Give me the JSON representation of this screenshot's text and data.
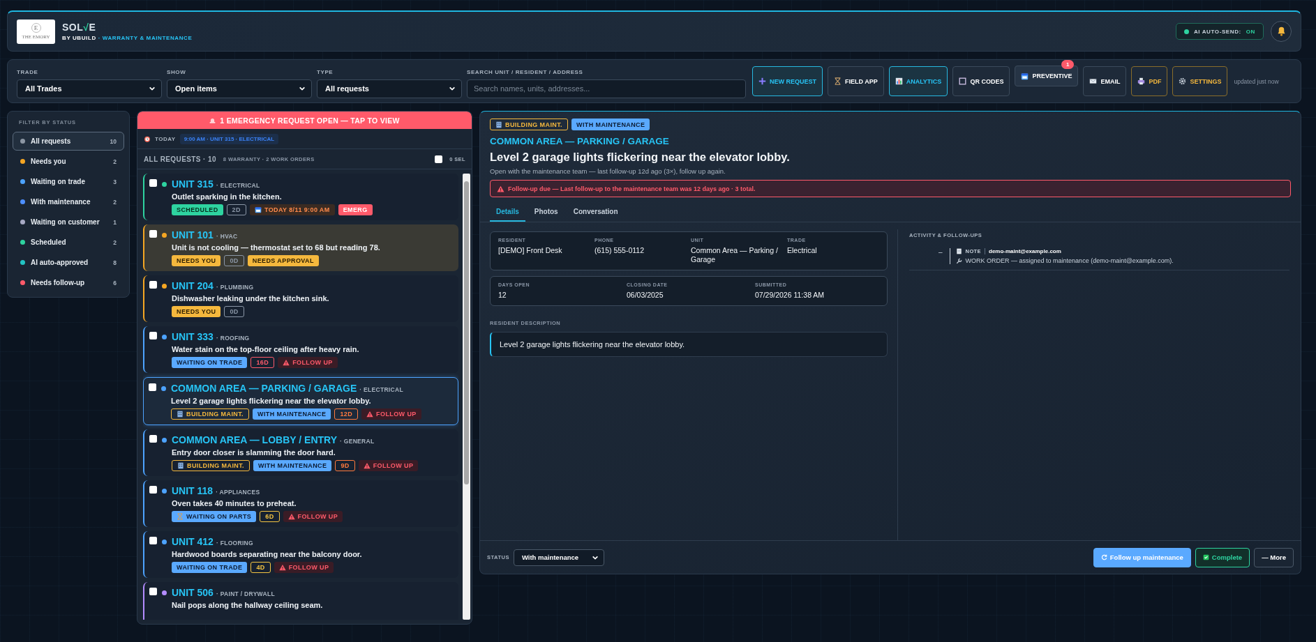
{
  "header": {
    "logo": {
      "initial": "E",
      "name": "THE EMORY"
    },
    "brand": {
      "name_parts": [
        "SOL",
        "√",
        "E"
      ],
      "tagline_parts": [
        "BY UBUILD",
        " · WARRANTY & MAINTENANCE"
      ]
    },
    "auto_send": {
      "label": "AI AUTO-SEND:",
      "value": "ON",
      "on": true
    }
  },
  "toolbar": {
    "filters": [
      {
        "label": "TRADE",
        "value": "All Trades"
      },
      {
        "label": "SHOW",
        "value": "Open items"
      },
      {
        "label": "TYPE",
        "value": "All requests"
      }
    ],
    "search": {
      "label": "SEARCH UNIT / RESIDENT / ADDRESS",
      "placeholder": "Search names, units, addresses..."
    },
    "buttons": [
      {
        "label": "NEW REQUEST",
        "kind": "accent"
      },
      {
        "label": "FIELD APP",
        "kind": "plain"
      },
      {
        "label": "ANALYTICS",
        "kind": "accent"
      },
      {
        "label": "QR CODES",
        "kind": "plain"
      },
      {
        "label": "PREVENTIVE",
        "kind": "compact",
        "badge": "1"
      },
      {
        "label": "EMAIL",
        "kind": "plain"
      },
      {
        "label": "PDF",
        "kind": "gold"
      },
      {
        "label": "SETTINGS",
        "kind": "gold"
      }
    ],
    "updated": "updated just now"
  },
  "sidebar": {
    "title": "FILTER BY STATUS",
    "items": [
      {
        "label": "All requests",
        "count": "10",
        "color": "#8c96a3",
        "selected": true
      },
      {
        "label": "Needs you",
        "count": "2",
        "color": "#f5a623",
        "selected": false
      },
      {
        "label": "Waiting on trade",
        "count": "3",
        "color": "#4da3ff",
        "selected": false
      },
      {
        "label": "With maintenance",
        "count": "2",
        "color": "#4d8fff",
        "selected": false
      },
      {
        "label": "Waiting on customer",
        "count": "1",
        "color": "#a7a9c4",
        "selected": false
      },
      {
        "label": "Scheduled",
        "count": "2",
        "color": "#2ed3a0",
        "selected": false
      },
      {
        "label": "AI auto-approved",
        "count": "8",
        "color": "#22c4c4",
        "selected": false
      },
      {
        "label": "Needs follow-up",
        "count": "6",
        "color": "#ff5a6a",
        "selected": false
      }
    ]
  },
  "list": {
    "emergency_banner": "1 EMERGENCY REQUEST OPEN — TAP TO VIEW",
    "today": {
      "label": "TODAY",
      "event": "9:00 AM · UNIT 315 · ELECTRICAL"
    },
    "heading": "ALL REQUESTS · 10",
    "breakdown": "8 WARRANTY · 2 WORK ORDERS",
    "select_all": {
      "checked": false,
      "label": "0 SEL"
    },
    "items": [
      {
        "unit": "UNIT 315",
        "trade": "· ELECTRICAL",
        "description": "Outlet sparking in the kitchen.",
        "color": "#2ed3a0",
        "checked": false,
        "selected": false,
        "highlighted": false,
        "tags": [
          {
            "kind": "scheduled",
            "text": "SCHEDULED"
          },
          {
            "kind": "age",
            "text": "2D",
            "color": "#8a96a6"
          },
          {
            "kind": "date",
            "text": "TODAY 8/11 9:00 AM"
          },
          {
            "kind": "emergency",
            "text": "EMERG"
          }
        ]
      },
      {
        "unit": "UNIT 101",
        "trade": "· HVAC",
        "description": "Unit is not cooling — thermostat set to 68 but reading 78.",
        "color": "#f5a623",
        "checked": false,
        "selected": false,
        "highlighted": true,
        "tags": [
          {
            "kind": "needs",
            "text": "NEEDS YOU"
          },
          {
            "kind": "age",
            "text": "0D",
            "color": "#8a96a6"
          },
          {
            "kind": "needs",
            "text": "NEEDS APPROVAL"
          }
        ]
      },
      {
        "unit": "UNIT 204",
        "trade": "· PLUMBING",
        "description": "Dishwasher leaking under the kitchen sink.",
        "color": "#f5a623",
        "checked": false,
        "selected": false,
        "highlighted": false,
        "tags": [
          {
            "kind": "needs",
            "text": "NEEDS YOU"
          },
          {
            "kind": "age",
            "text": "0D",
            "color": "#8a96a6"
          }
        ]
      },
      {
        "unit": "UNIT 333",
        "trade": "· ROOFING",
        "description": "Water stain on the top-floor ceiling after heavy rain.",
        "color": "#4da3ff",
        "checked": false,
        "selected": false,
        "highlighted": false,
        "tags": [
          {
            "kind": "waiting",
            "text": "WAITING ON TRADE"
          },
          {
            "kind": "age",
            "text": "16D",
            "color": "#ff5a6a"
          },
          {
            "kind": "followup",
            "text": "FOLLOW UP"
          }
        ]
      },
      {
        "unit": "COMMON AREA — PARKING / GARAGE",
        "trade": "· ELECTRICAL",
        "description": "Level 2 garage lights flickering near the elevator lobby.",
        "color": "#4da3ff",
        "checked": false,
        "selected": true,
        "highlighted": false,
        "tags": [
          {
            "kind": "building",
            "text": "BUILDING MAINT."
          },
          {
            "kind": "waiting",
            "text": "WITH MAINTENANCE"
          },
          {
            "kind": "age",
            "text": "12D",
            "color": "#ff7a3d"
          },
          {
            "kind": "followup",
            "text": "FOLLOW UP"
          }
        ]
      },
      {
        "unit": "COMMON AREA — LOBBY / ENTRY",
        "trade": "· GENERAL",
        "description": "Entry door closer is slamming the door hard.",
        "color": "#4da3ff",
        "checked": false,
        "selected": false,
        "highlighted": false,
        "tags": [
          {
            "kind": "building",
            "text": "BUILDING MAINT."
          },
          {
            "kind": "waiting",
            "text": "WITH MAINTENANCE"
          },
          {
            "kind": "age",
            "text": "9D",
            "color": "#ff7a3d"
          },
          {
            "kind": "followup",
            "text": "FOLLOW UP"
          }
        ]
      },
      {
        "unit": "UNIT 118",
        "trade": "· APPLIANCES",
        "description": "Oven takes 40 minutes to preheat.",
        "color": "#4da3ff",
        "checked": false,
        "selected": false,
        "highlighted": false,
        "tags": [
          {
            "kind": "parts",
            "text": "WAITING ON PARTS"
          },
          {
            "kind": "age",
            "text": "6D",
            "color": "#f5c542"
          },
          {
            "kind": "followup",
            "text": "FOLLOW UP"
          }
        ]
      },
      {
        "unit": "UNIT 412",
        "trade": "· FLOORING",
        "description": "Hardwood boards separating near the balcony door.",
        "color": "#4da3ff",
        "checked": false,
        "selected": false,
        "highlighted": false,
        "tags": [
          {
            "kind": "waiting",
            "text": "WAITING ON TRADE"
          },
          {
            "kind": "age",
            "text": "4D",
            "color": "#f5c542"
          },
          {
            "kind": "followup",
            "text": "FOLLOW UP"
          }
        ]
      },
      {
        "unit": "UNIT 506",
        "trade": "· PAINT / DRYWALL",
        "description": "Nail pops along the hallway ceiling seam.",
        "color": "#b48cff",
        "checked": false,
        "selected": false,
        "highlighted": false
      }
    ]
  },
  "detail": {
    "chips": [
      {
        "kind": "building",
        "text": "BUILDING MAINT."
      },
      {
        "kind": "waiting",
        "text": "WITH MAINTENANCE"
      }
    ],
    "location": "COMMON AREA — PARKING / GARAGE",
    "title": "Level 2 garage lights flickering near the elevator lobby.",
    "subtitle": "Open with the maintenance team — last follow-up 12d ago (3×), follow up again.",
    "alert": "Follow-up due — Last follow-up to the maintenance team was 12 days ago · 3 total.",
    "tabs": [
      {
        "label": "Details",
        "selected": true
      },
      {
        "label": "Photos",
        "selected": false
      },
      {
        "label": "Conversation",
        "selected": false
      }
    ],
    "field_groups": [
      {
        "fields": [
          {
            "label": "RESIDENT",
            "value": "[DEMO] Front Desk"
          },
          {
            "label": "PHONE",
            "value": "(615) 555-0112"
          },
          {
            "label": "UNIT",
            "value": "Common Area — Parking / Garage"
          },
          {
            "label": "TRADE",
            "value": "Electrical"
          }
        ]
      },
      {
        "fields": [
          {
            "label": "DAYS OPEN",
            "value": "12"
          },
          {
            "label": "CLOSING DATE",
            "value": "06/03/2025"
          },
          {
            "label": "SUBMITTED",
            "value": "07/29/2026 11:38 AM"
          }
        ]
      }
    ],
    "description_label": "RESIDENT DESCRIPTION",
    "description": "Level 2 garage lights flickering near the elevator lobby.",
    "activity": {
      "title": "ACTIVITY & FOLLOW-UPS",
      "entries": [
        {
          "marker": "–",
          "note_label": "NOTE",
          "author": "demo-maint@example.com",
          "text": "WORK ORDER — assigned to maintenance (demo-maint@example.com)."
        }
      ]
    },
    "footer": {
      "status_label": "STATUS",
      "status_value": "With maintenance",
      "buttons": [
        {
          "label": "Follow up maintenance",
          "kind": "primary"
        },
        {
          "label": "Complete",
          "kind": "success"
        },
        {
          "label": "— More",
          "kind": "plain"
        }
      ]
    }
  }
}
